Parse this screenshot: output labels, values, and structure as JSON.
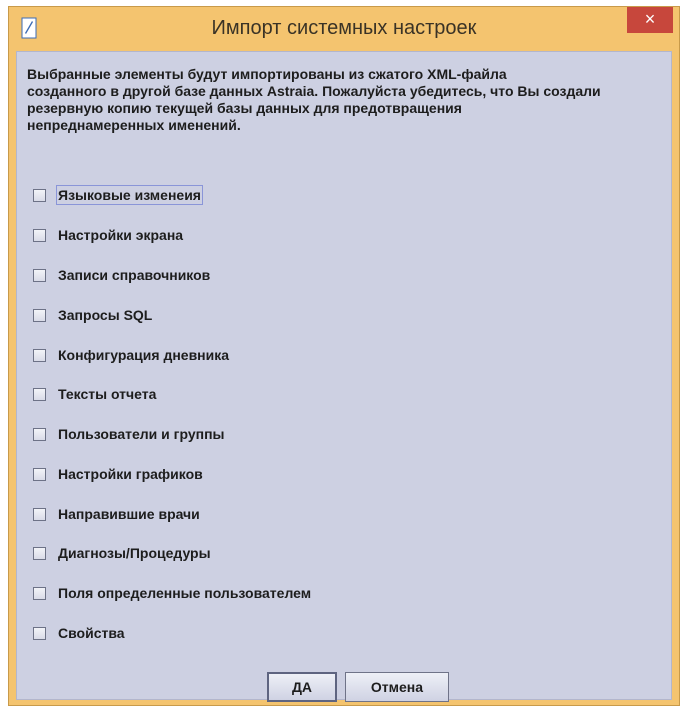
{
  "window": {
    "title": "Импорт системных настроек",
    "close_glyph": "×",
    "app_icon": "java-app-icon",
    "accent_color": "#f4c46f",
    "close_color": "#c7473c"
  },
  "description": "Выбранные элементы будут импортированы из сжатого XML-файла\nсозданного в другой базе данных Astraia. Пожалуйста убедитесь, что Вы создали\nрезервную копию текущей базы данных для предотвращения\nнепреднамеренных именений.",
  "options": [
    {
      "label": "Языковые изменеия",
      "checked": false,
      "focused": true
    },
    {
      "label": "Настройки экрана",
      "checked": false
    },
    {
      "label": "Записи справочников",
      "checked": false
    },
    {
      "label": "Запросы SQL",
      "checked": false
    },
    {
      "label": "Конфигурация дневника",
      "checked": false
    },
    {
      "label": "Тексты отчета",
      "checked": false
    },
    {
      "label": "Пользователи и группы",
      "checked": false
    },
    {
      "label": "Настройки графиков",
      "checked": false
    },
    {
      "label": "Направившие врачи",
      "checked": false
    },
    {
      "label": "Диагнозы/Процедуры",
      "checked": false
    },
    {
      "label": "Поля определенные пользователем",
      "checked": false
    },
    {
      "label": "Свойства",
      "checked": false
    }
  ],
  "buttons": {
    "ok_label": "ДА",
    "cancel_label": "Отмена"
  }
}
